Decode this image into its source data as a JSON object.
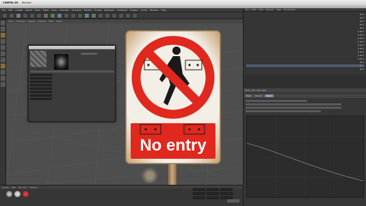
{
  "mac_menu": {
    "app": "CINEMA 4D",
    "items": [
      "Window"
    ],
    "clock": ""
  },
  "window_title": "",
  "c4d_menu": [
    "File",
    "Edit",
    "Create",
    "Select",
    "Tools",
    "Mesh",
    "Snap",
    "Animate",
    "Simulate",
    "Render",
    "Sculpt",
    "MoGraph",
    "Character",
    "Plugins",
    "Script",
    "Window",
    "Help"
  ],
  "viewport": {
    "menu": [
      "View",
      "Cameras",
      "Display",
      "Options",
      "Filter",
      "Panel"
    ]
  },
  "sign": {
    "text": "No entry",
    "colors": {
      "red": "#e0281e",
      "white": "#f3efe6",
      "black": "#1a1a1a",
      "rust": "#b07a42"
    }
  },
  "dialog": {
    "title": "",
    "button": ""
  },
  "right_panel": {
    "menu": [
      "File",
      "Edit",
      "View",
      "Objects",
      "Tags",
      "Bookmarks"
    ],
    "attr_tabs": [
      "Basic",
      "Coord.",
      "Object"
    ],
    "attr_menu": [
      "Mode",
      "Edit",
      "User Data"
    ]
  },
  "bottom_panel": {
    "menu": [
      "Create",
      "Edit",
      "Function",
      "Texture"
    ]
  }
}
